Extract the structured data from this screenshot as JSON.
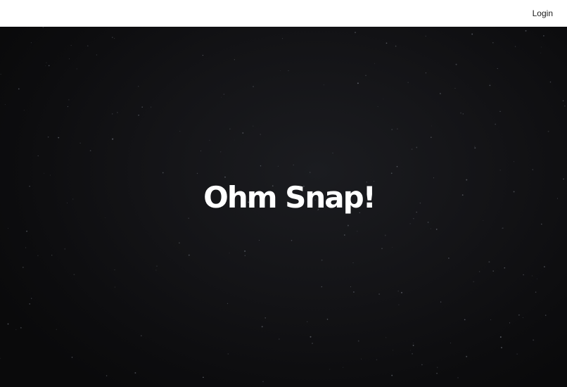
{
  "header": {
    "login_label": "Login"
  },
  "hero": {
    "title": "Ohm Snap!"
  },
  "colors": {
    "header_bg": "#ffffff",
    "hero_bg": "#0d0d0f",
    "title_color": "#ffffff",
    "star_color": "#6b6f78"
  }
}
